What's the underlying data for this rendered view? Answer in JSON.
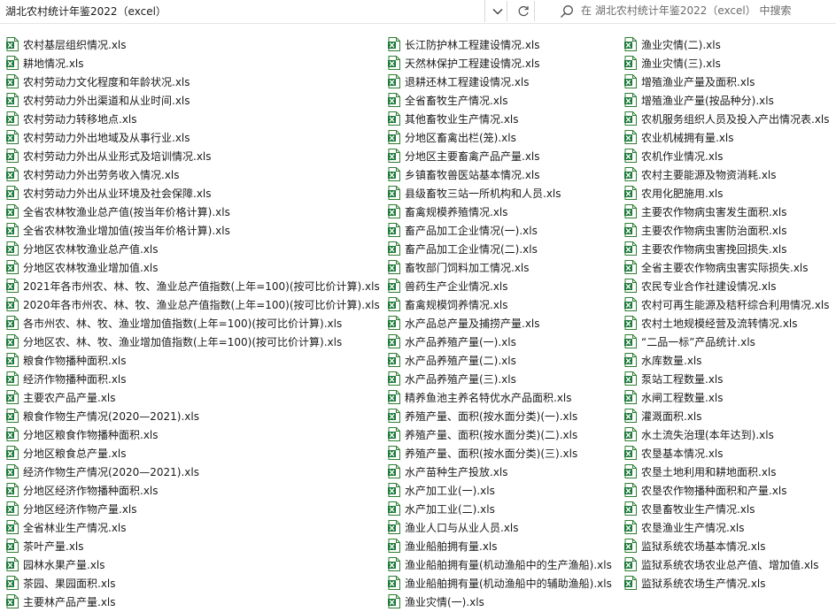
{
  "address": {
    "path": "湖北农村统计年鉴2022（excel）"
  },
  "search": {
    "placeholder": "在 湖北农村统计年鉴2022（excel） 中搜索"
  },
  "columns": [
    [
      "农村基层组织情况.xls",
      "耕地情况.xls",
      "农村劳动力文化程度和年龄状况.xls",
      "农村劳动力外出渠道和从业时间.xls",
      "农村劳动力转移地点.xls",
      "农村劳动力外出地域及从事行业.xls",
      "农村劳动力外出从业形式及培训情况.xls",
      "农村劳动力外出劳务收入情况.xls",
      "农村劳动力外出从业环境及社会保障.xls",
      "全省农林牧渔业总产值(按当年价格计算).xls",
      "全省农林牧渔业增加值(按当年价格计算).xls",
      "分地区农林牧渔业总产值.xls",
      "分地区农林牧渔业增加值.xls",
      "2021年各市州农、林、牧、渔业总产值指数(上年=100)(按可比价计算).xls",
      "2020年各市州农、林、牧、渔业总产值指数(上年=100)(按可比价计算).xls",
      "各市州农、林、牧、渔业增加值指数(上年=100)(按可比价计算).xls",
      "分地区农、林、牧、渔业增加值指数(上年=100)(按可比价计算).xls",
      "粮食作物播种面积.xls",
      "经济作物播种面积.xls",
      "主要农产品产量.xls",
      "粮食作物生产情况(2020—2021).xls",
      "分地区粮食作物播种面积.xls",
      "分地区粮食总产量.xls",
      "经济作物生产情况(2020—2021).xls",
      "分地区经济作物播种面积.xls",
      "分地区经济作物产量.xls",
      "全省林业生产情况.xls",
      "茶叶产量.xls",
      "园林水果产量.xls",
      "茶园、果园面积.xls",
      "主要林产品产量.xls"
    ],
    [
      "长江防护林工程建设情况.xls",
      "天然林保护工程建设情况.xls",
      "退耕还林工程建设情况.xls",
      "全省畜牧生产情况.xls",
      "其他畜牧业生产情况.xls",
      "分地区畜禽出栏(笼).xls",
      "分地区主要畜禽产品产量.xls",
      "乡镇畜牧兽医站基本情况.xls",
      "县级畜牧三站一所机构和人员.xls",
      "畜禽规模养殖情况.xls",
      "畜产品加工企业情况(一).xls",
      "畜产品加工企业情况(二).xls",
      "畜牧部门饲料加工情况.xls",
      "兽药生产企业情况.xls",
      "畜禽规模饲养情况.xls",
      "水产品总产量及捕捞产量.xls",
      "水产品养殖产量(一).xls",
      "水产品养殖产量(二).xls",
      "水产品养殖产量(三).xls",
      "精养鱼池主养名特优水产品面积.xls",
      "养殖产量、面积(按水面分类)(一).xls",
      "养殖产量、面积(按水面分类)(二).xls",
      "养殖产量、面积(按水面分类)(三).xls",
      "水产苗种生产投放.xls",
      "水产加工业(一).xls",
      "水产加工业(二).xls",
      "渔业人口与从业人员.xls",
      "渔业船舶拥有量.xls",
      "渔业船舶拥有量(机动渔船中的生产渔船).xls",
      "渔业船舶拥有量(机动渔船中的辅助渔船).xls",
      "渔业灾情(一).xls"
    ],
    [
      "渔业灾情(二).xls",
      "渔业灾情(三).xls",
      "增殖渔业产量及面积.xls",
      "增殖渔业产量(按品种分).xls",
      "农机服务组织人员及投入产出情况表.xls",
      "农业机械拥有量.xls",
      "农机作业情况.xls",
      "农村主要能源及物资消耗.xls",
      "农用化肥施用.xls",
      "主要农作物病虫害发生面积.xls",
      "主要农作物病虫害防治面积.xls",
      "主要农作物病虫害挽回损失.xls",
      "全省主要农作物病虫害实际损失.xls",
      "农民专业合作社建设情况.xls",
      "农村可再生能源及秸秆综合利用情况.xls",
      "农村土地规模经营及流转情况.xls",
      "“二品一标”产品统计.xls",
      "水库数量.xls",
      "泵站工程数量.xls",
      "水闸工程数量.xls",
      "灌溉面积.xls",
      "水土流失治理(本年达到).xls",
      "农垦基本情况.xls",
      "农垦土地利用和耕地面积.xls",
      "农垦农作物播种面积和产量.xls",
      "农垦畜牧业生产情况.xls",
      "农垦渔业生产情况.xls",
      "监狱系统农场基本情况.xls",
      "监狱系统农场农业总产值、增加值.xls",
      "监狱系统农场生产情况.xls"
    ]
  ]
}
